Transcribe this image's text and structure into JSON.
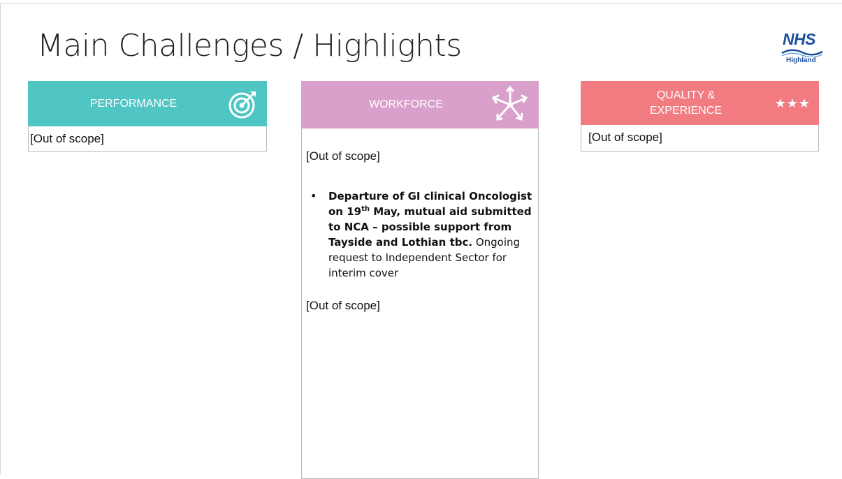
{
  "slide": {
    "title": "Main Challenges / Highlights",
    "logo": {
      "brand": "NHS",
      "region": "Highland"
    }
  },
  "columns": {
    "performance": {
      "header": "PERFORMANCE",
      "icon": "target-icon",
      "color": "#4fc5c4",
      "body": "[Out of scope]"
    },
    "workforce": {
      "header": "WORKFORCE",
      "icon": "hands-circle-icon",
      "color": "#d9a0cc",
      "top_text": "[Out of scope]",
      "bullet": {
        "bold_part1": "Departure of GI clinical Oncologist on 19",
        "sup": "th",
        "bold_part2": " May, mutual aid submitted to NCA – possible support from Tayside and Lothian tbc.",
        "normal_part": " Ongoing request to Independent Sector for interim cover"
      },
      "bottom_text": "[Out of scope]"
    },
    "quality": {
      "header_line1": "QUALITY &",
      "header_line2": "EXPERIENCE",
      "icon": "three-stars-icon",
      "stars": "★★★",
      "color": "#f27b82",
      "body": "[Out of scope]"
    }
  }
}
